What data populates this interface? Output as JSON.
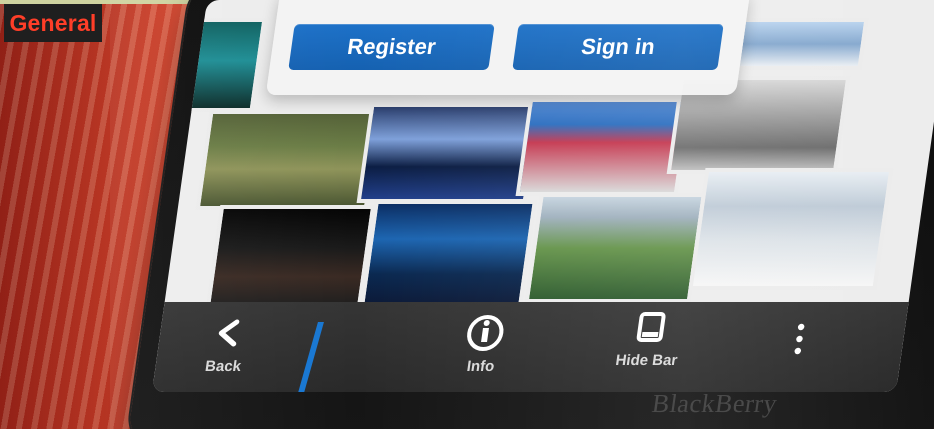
{
  "badge": {
    "label": "General"
  },
  "dialog": {
    "register_label": "Register",
    "signin_label": "Sign in"
  },
  "action_bar": {
    "back_label": "Back",
    "info_label": "Info",
    "hide_bar_label": "Hide Bar"
  },
  "brand": {
    "text": "BlackBerry"
  },
  "icons": {
    "back": "back-icon",
    "info": "info-icon",
    "hide_bar": "hide-bar-icon",
    "more": "more-icon"
  },
  "colors": {
    "accent_blue": "#1877d2",
    "badge_red": "#ff3e28",
    "button_blue": "#1561b1",
    "bar_dark": "#2f2f2f"
  }
}
